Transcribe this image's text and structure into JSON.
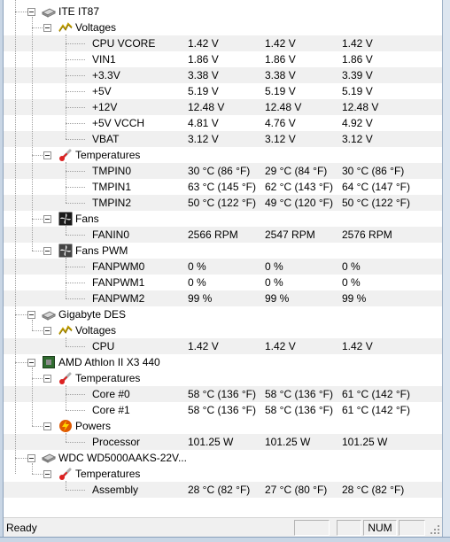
{
  "tree": [
    {
      "level": 0,
      "icon": "chip-icon",
      "label": "ITE IT87",
      "v": [
        "",
        "",
        ""
      ],
      "alt": false
    },
    {
      "level": 1,
      "icon": "voltage-icon",
      "label": "Voltages",
      "v": [
        "",
        "",
        ""
      ],
      "alt": false
    },
    {
      "level": 2,
      "icon": "",
      "label": "CPU VCORE",
      "v": [
        "1.42 V",
        "1.42 V",
        "1.42 V"
      ],
      "alt": true
    },
    {
      "level": 2,
      "icon": "",
      "label": "VIN1",
      "v": [
        "1.86 V",
        "1.86 V",
        "1.86 V"
      ],
      "alt": false
    },
    {
      "level": 2,
      "icon": "",
      "label": "+3.3V",
      "v": [
        "3.38 V",
        "3.38 V",
        "3.39 V"
      ],
      "alt": true
    },
    {
      "level": 2,
      "icon": "",
      "label": "+5V",
      "v": [
        "5.19 V",
        "5.19 V",
        "5.19 V"
      ],
      "alt": false
    },
    {
      "level": 2,
      "icon": "",
      "label": "+12V",
      "v": [
        "12.48 V",
        "12.48 V",
        "12.48 V"
      ],
      "alt": true
    },
    {
      "level": 2,
      "icon": "",
      "label": "+5V VCCH",
      "v": [
        "4.81 V",
        "4.76 V",
        "4.92 V"
      ],
      "alt": false
    },
    {
      "level": 2,
      "icon": "",
      "label": "VBAT",
      "v": [
        "3.12 V",
        "3.12 V",
        "3.12 V"
      ],
      "alt": true
    },
    {
      "level": 1,
      "icon": "thermometer-icon",
      "label": "Temperatures",
      "v": [
        "",
        "",
        ""
      ],
      "alt": false
    },
    {
      "level": 2,
      "icon": "",
      "label": "TMPIN0",
      "v": [
        "30 °C  (86 °F)",
        "29 °C  (84 °F)",
        "30 °C  (86 °F)"
      ],
      "alt": true
    },
    {
      "level": 2,
      "icon": "",
      "label": "TMPIN1",
      "v": [
        "63 °C  (145 °F)",
        "62 °C  (143 °F)",
        "64 °C  (147 °F)"
      ],
      "alt": false
    },
    {
      "level": 2,
      "icon": "",
      "label": "TMPIN2",
      "v": [
        "50 °C  (122 °F)",
        "49 °C  (120 °F)",
        "50 °C  (122 °F)"
      ],
      "alt": true
    },
    {
      "level": 1,
      "icon": "fan-icon",
      "label": "Fans",
      "v": [
        "",
        "",
        ""
      ],
      "alt": false
    },
    {
      "level": 2,
      "icon": "",
      "label": "FANIN0",
      "v": [
        "2566 RPM",
        "2547 RPM",
        "2576 RPM"
      ],
      "alt": true
    },
    {
      "level": 1,
      "icon": "fan-pwm-icon",
      "label": "Fans PWM",
      "v": [
        "",
        "",
        ""
      ],
      "alt": false
    },
    {
      "level": 2,
      "icon": "",
      "label": "FANPWM0",
      "v": [
        "0 %",
        "0 %",
        "0 %"
      ],
      "alt": true
    },
    {
      "level": 2,
      "icon": "",
      "label": "FANPWM1",
      "v": [
        "0 %",
        "0 %",
        "0 %"
      ],
      "alt": false
    },
    {
      "level": 2,
      "icon": "",
      "label": "FANPWM2",
      "v": [
        "99 %",
        "99 %",
        "99 %"
      ],
      "alt": true
    },
    {
      "level": 0,
      "icon": "chip-icon",
      "label": "Gigabyte DES",
      "v": [
        "",
        "",
        ""
      ],
      "alt": false
    },
    {
      "level": 1,
      "icon": "voltage-icon",
      "label": "Voltages",
      "v": [
        "",
        "",
        ""
      ],
      "alt": false
    },
    {
      "level": 2,
      "icon": "",
      "label": "CPU",
      "v": [
        "1.42 V",
        "1.42 V",
        "1.42 V"
      ],
      "alt": true
    },
    {
      "level": 0,
      "icon": "cpu-icon",
      "label": "AMD Athlon II X3 440",
      "v": [
        "",
        "",
        ""
      ],
      "alt": false
    },
    {
      "level": 1,
      "icon": "thermometer-icon",
      "label": "Temperatures",
      "v": [
        "",
        "",
        ""
      ],
      "alt": false
    },
    {
      "level": 2,
      "icon": "",
      "label": "Core #0",
      "v": [
        "58 °C  (136 °F)",
        "58 °C  (136 °F)",
        "61 °C  (142 °F)"
      ],
      "alt": true
    },
    {
      "level": 2,
      "icon": "",
      "label": "Core #1",
      "v": [
        "58 °C  (136 °F)",
        "58 °C  (136 °F)",
        "61 °C  (142 °F)"
      ],
      "alt": false
    },
    {
      "level": 1,
      "icon": "power-icon",
      "label": "Powers",
      "v": [
        "",
        "",
        ""
      ],
      "alt": false
    },
    {
      "level": 2,
      "icon": "",
      "label": "Processor",
      "v": [
        "101.25 W",
        "101.25 W",
        "101.25 W"
      ],
      "alt": true
    },
    {
      "level": 0,
      "icon": "hard-drive-icon",
      "label": "WDC WD5000AAKS-22V...",
      "v": [
        "",
        "",
        ""
      ],
      "alt": false
    },
    {
      "level": 1,
      "icon": "thermometer-icon",
      "label": "Temperatures",
      "v": [
        "",
        "",
        ""
      ],
      "alt": false
    },
    {
      "level": 2,
      "icon": "",
      "label": "Assembly",
      "v": [
        "28 °C  (82 °F)",
        "27 °C  (80 °F)",
        "28 °C  (82 °F)"
      ],
      "alt": true
    }
  ],
  "statusbar": {
    "text": "Ready",
    "num_indicator": "NUM"
  },
  "colors": {
    "alt_row": "#f0f0f0",
    "tree_line": "#a0a0a0",
    "frame": "#c9d6e5"
  }
}
